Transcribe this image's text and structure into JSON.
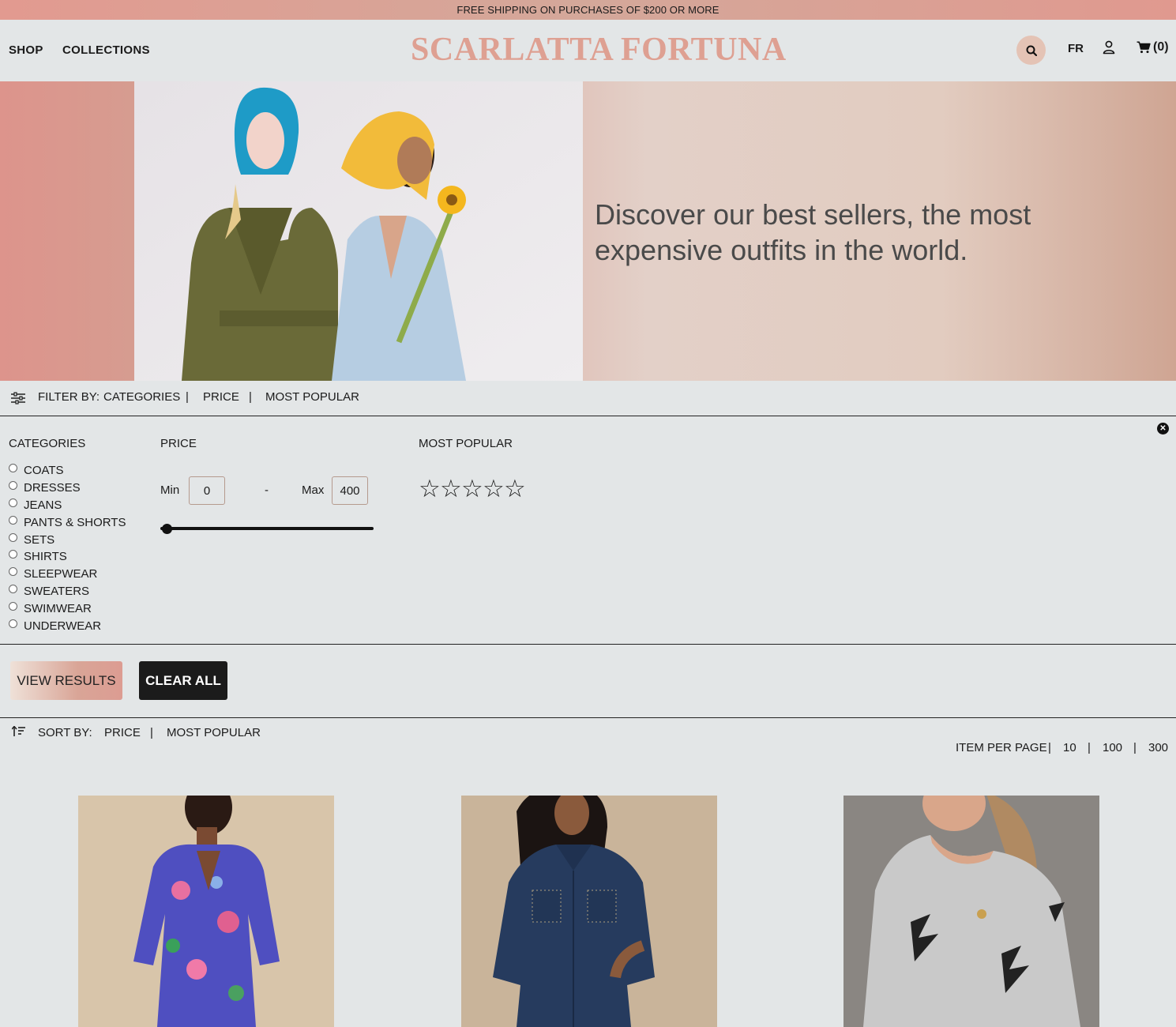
{
  "announcement": "FREE SHIPPING ON PURCHASES OF $200 OR MORE",
  "header": {
    "nav": [
      "SHOP",
      "COLLECTIONS"
    ],
    "logo": "SCARLATTA FORTUNA",
    "lang": "FR",
    "cart_count": "(0)",
    "icons": [
      "search-icon",
      "user-icon",
      "cart-icon"
    ]
  },
  "hero": {
    "headline": "Discover our best sellers, the most expensive outfits in the world."
  },
  "filter_bar": {
    "label": "FILTER BY:",
    "options": [
      "CATEGORIES",
      "PRICE",
      "MOST POPULAR"
    ],
    "separator": "|"
  },
  "filter_panel": {
    "categories_title": "CATEGORIES",
    "categories": [
      "COATS",
      "DRESSES",
      "JEANS",
      "PANTS & SHORTS",
      "SETS",
      "SHIRTS",
      "SLEEPWEAR",
      "SWEATERS",
      "SWIMWEAR",
      "UNDERWEAR"
    ],
    "price_title": "PRICE",
    "min_label": "Min",
    "min_value": "0",
    "dash": "-",
    "max_label": "Max",
    "max_value": "400",
    "popular_title": "MOST POPULAR",
    "star_rating": 0,
    "star_count": 5,
    "close_icon": "close-icon"
  },
  "actions": {
    "view_results": "VIEW RESULTS",
    "clear_all": "CLEAR ALL"
  },
  "sort_bar": {
    "label": "SORT BY:",
    "options": [
      "PRICE",
      "MOST POPULAR"
    ],
    "separator": "|"
  },
  "per_page": {
    "label": "ITEM PER PAGE",
    "options": [
      "10",
      "100",
      "300"
    ],
    "separator": "|"
  },
  "colors": {
    "brand": "#dea092",
    "announcement_bg": "#d4a89a",
    "dark": "#1b1b1b",
    "page_bg": "#e3e6e7"
  }
}
